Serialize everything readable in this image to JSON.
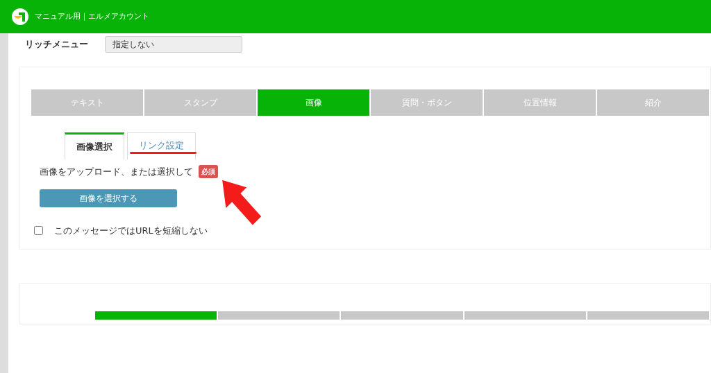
{
  "header": {
    "title": "マニュアル用｜エルメアカウント"
  },
  "rich_menu": {
    "label": "リッチメニュー",
    "value": "指定しない"
  },
  "message_panel": {
    "type_tabs": [
      {
        "label": "テキスト",
        "selected": false
      },
      {
        "label": "スタンプ",
        "selected": false
      },
      {
        "label": "画像",
        "selected": true
      },
      {
        "label": "質問・ボタン",
        "selected": false
      },
      {
        "label": "位置情報",
        "selected": false
      },
      {
        "label": "紹介",
        "selected": false
      }
    ],
    "sub_tabs": [
      {
        "label": "画像選択",
        "selected": true
      },
      {
        "label": "リンク設定",
        "selected": false
      }
    ],
    "upload_label": "画像をアップロード、または選択して",
    "required_badge": "必須",
    "select_button": "画像を選択する",
    "no_shorten": {
      "label": "このメッセージではURLを短縮しない",
      "checked": false
    }
  },
  "second_panel": {
    "type_tabs": [
      {
        "selected": true
      },
      {
        "selected": false
      },
      {
        "selected": false
      },
      {
        "selected": false
      },
      {
        "selected": false
      }
    ]
  }
}
